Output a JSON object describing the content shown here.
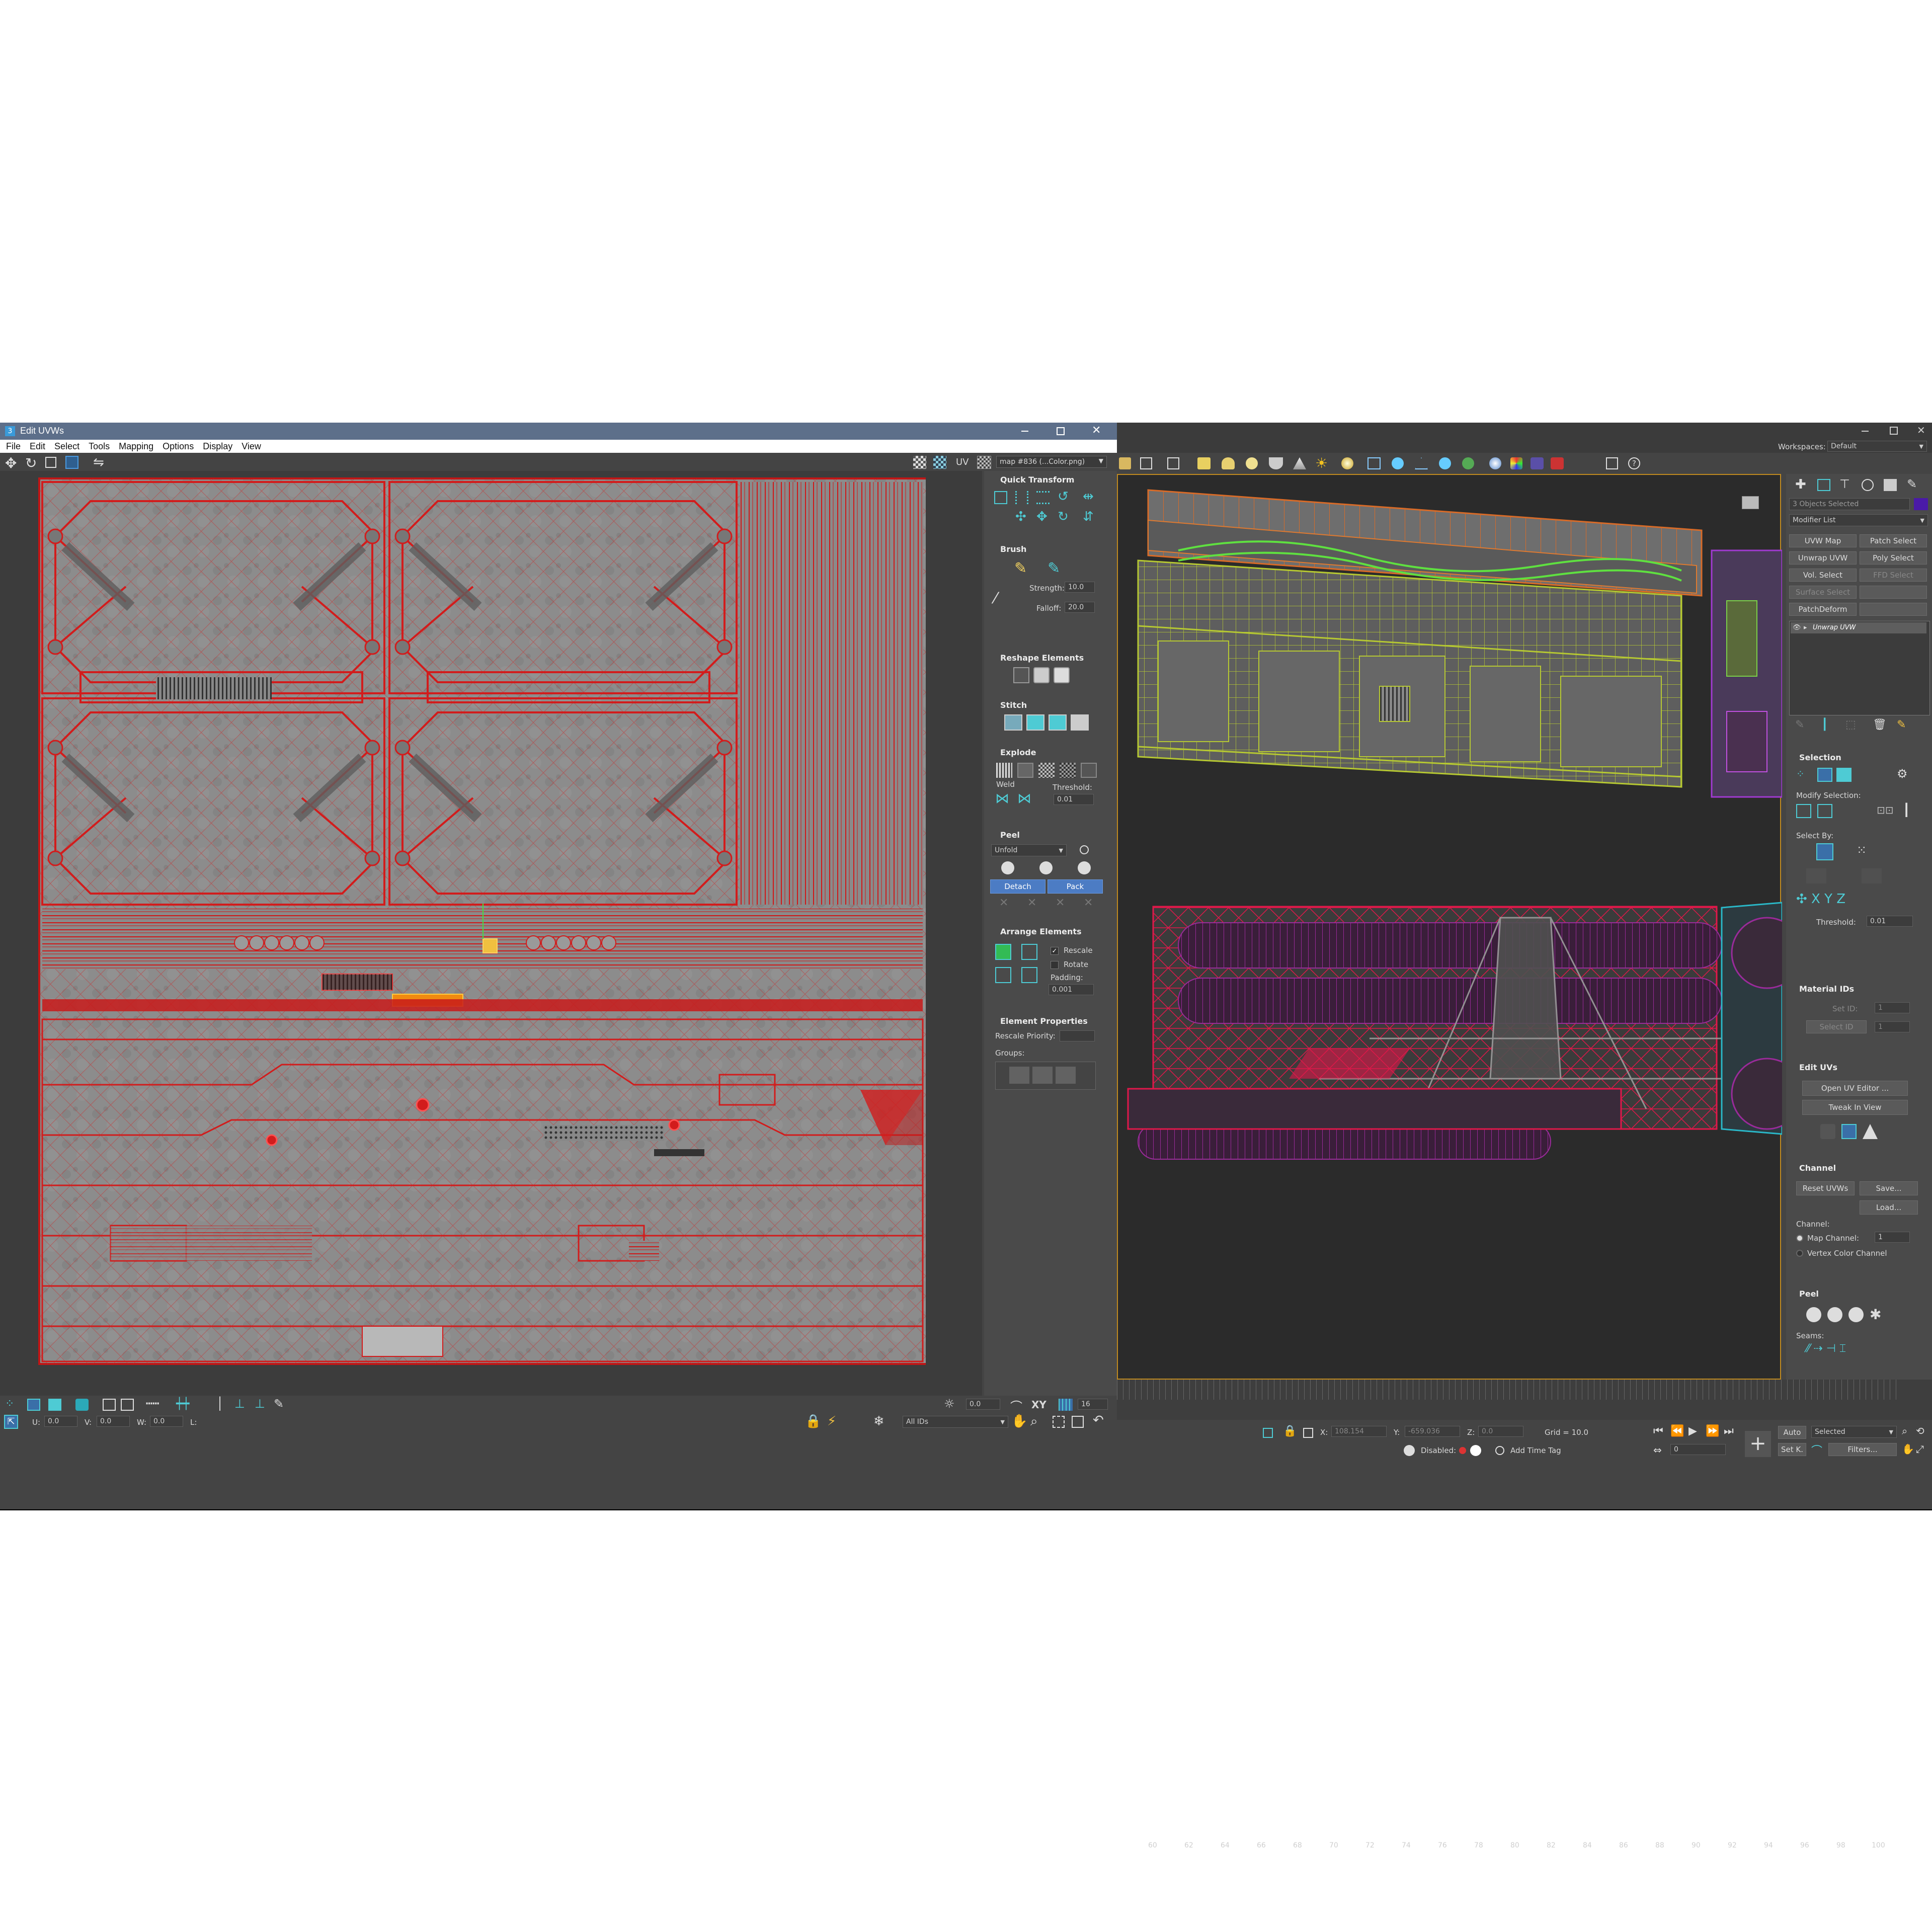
{
  "uv_editor": {
    "title": "Edit UVWs",
    "menu": [
      "File",
      "Edit",
      "Select",
      "Tools",
      "Mapping",
      "Options",
      "Display",
      "View"
    ],
    "uv_label": "UV",
    "map_dropdown": "map #836 (...Color.png)",
    "panels": {
      "quick_transform": "Quick Transform",
      "brush": "Brush",
      "strength_label": "Strength:",
      "strength_value": "10.0",
      "falloff_label": "Falloff:",
      "falloff_value": "20.0",
      "reshape": "Reshape Elements",
      "stitch": "Stitch",
      "explode": "Explode",
      "weld_label": "Weld",
      "threshold_label": "Threshold:",
      "threshold_value": "0.01",
      "peel": "Peel",
      "unfold_value": "Unfold",
      "detach": "Detach",
      "pack": "Pack",
      "arrange": "Arrange Elements",
      "rescale": "Rescale",
      "rotate": "Rotate",
      "padding_label": "Padding:",
      "padding_value": "0.001",
      "element_props": "Element Properties",
      "rescale_priority": "Rescale Priority:",
      "groups": "Groups:"
    },
    "bottom": {
      "zoom_value": "0.0",
      "xy_label": "XY",
      "grid_value": "16",
      "u_label": "U:",
      "u_value": "0.0",
      "v_label": "V:",
      "v_value": "0.0",
      "w_label": "W:",
      "w_value": "0.0",
      "l_label": "L:",
      "ids_dropdown": "All IDs"
    }
  },
  "max": {
    "workspaces_label": "Workspaces:",
    "workspace_value": "Default",
    "objects_selected": "3 Objects Selected",
    "modifier_list": "Modifier List",
    "modifier_buttons": [
      "UVW Map",
      "Patch Select",
      "Unwrap UVW",
      "Poly Select",
      "Vol. Select",
      "FFD Select",
      "Surface Select",
      "",
      "PatchDeform",
      ""
    ],
    "stack_item": "Unwrap UVW",
    "selection_head": "Selection",
    "modify_selection": "Modify Selection:",
    "select_by": "Select By:",
    "threshold_label": "Threshold:",
    "threshold_value": "0.01",
    "material_ids_head": "Material IDs",
    "set_id": "Set ID:",
    "select_id": "Select ID",
    "id_value": "1",
    "edit_uvs_head": "Edit UVs",
    "open_uv_editor": "Open UV Editor ...",
    "tweak_in_view": "Tweak In View",
    "channel_head": "Channel",
    "reset_uvws": "Reset UVWs",
    "save": "Save...",
    "load": "Load...",
    "channel_label": "Channel:",
    "map_channel": "Map Channel:",
    "map_channel_value": "1",
    "vertex_color_channel": "Vertex Color Channel",
    "peel_head": "Peel",
    "seams_label": "Seams:",
    "timeline_ticks": [
      "60",
      "62",
      "64",
      "66",
      "68",
      "70",
      "72",
      "74",
      "76",
      "78",
      "80",
      "82",
      "84",
      "86",
      "88",
      "90",
      "92",
      "94",
      "96",
      "98",
      "100"
    ],
    "x_label": "X:",
    "x_value": "108.154",
    "y_label": "Y:",
    "y_value": "-659.036",
    "z_label": "Z:",
    "z_value": "0.0",
    "grid_label": "Grid = 10.0",
    "disabled_label": "Disabled:",
    "add_time_tag": "Add Time Tag",
    "auto": "Auto",
    "set_k": "Set K.",
    "selected_dropdown": "Selected",
    "filters": "Filters...",
    "frame_value": "0"
  },
  "colors": {
    "uv_wire": "#e02020",
    "chrome": "#444444",
    "panel": "#3d3d3d",
    "accent_blue": "#4c7cc4",
    "viewport": "#2b2b2b"
  }
}
